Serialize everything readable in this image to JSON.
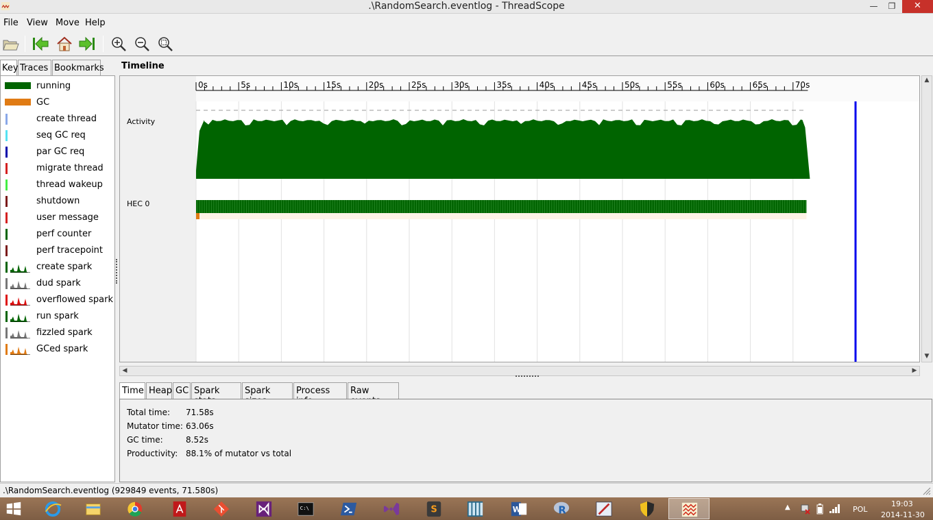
{
  "window": {
    "title": ".\\RandomSearch.eventlog - ThreadScope",
    "minimize_glyph": "—",
    "maximize_glyph": "❐",
    "close_glyph": "✕"
  },
  "menu": [
    {
      "label": "File"
    },
    {
      "label": "View"
    },
    {
      "label": "Move"
    },
    {
      "label": "Help"
    }
  ],
  "toolbar": {
    "buttons": [
      "open-icon",
      "jump-start-icon",
      "home-icon",
      "jump-end-icon",
      "zoom-in-icon",
      "zoom-out-icon",
      "zoom-fit-icon"
    ]
  },
  "left_tabs": [
    {
      "label": "Key",
      "selected": true
    },
    {
      "label": "Traces",
      "selected": false
    },
    {
      "label": "Bookmarks",
      "selected": false
    }
  ],
  "key": [
    {
      "label": "running",
      "type": "bar",
      "color": "#006400"
    },
    {
      "label": "GC",
      "type": "bar",
      "color": "#e07b14"
    },
    {
      "label": "create thread",
      "type": "line",
      "color": "#8aa8e8"
    },
    {
      "label": "seq GC req",
      "type": "line",
      "color": "#55e2f2"
    },
    {
      "label": "par GC req",
      "type": "line",
      "color": "#0000aa"
    },
    {
      "label": "migrate thread",
      "type": "line",
      "color": "#d42020"
    },
    {
      "label": "thread wakeup",
      "type": "line",
      "color": "#44ee44"
    },
    {
      "label": "shutdown",
      "type": "line",
      "color": "#7a1a1a"
    },
    {
      "label": "user message",
      "type": "line",
      "color": "#d42020"
    },
    {
      "label": "perf counter",
      "type": "line",
      "color": "#006400"
    },
    {
      "label": "perf tracepoint",
      "type": "line",
      "color": "#7a1a1a"
    },
    {
      "label": "create spark",
      "type": "spark",
      "color": "#006400"
    },
    {
      "label": "dud spark",
      "type": "spark",
      "color": "#777777"
    },
    {
      "label": "overflowed spark",
      "type": "spark",
      "color": "#dd1111"
    },
    {
      "label": "run spark",
      "type": "spark",
      "color": "#006400"
    },
    {
      "label": "fizzled spark",
      "type": "spark",
      "color": "#777777"
    },
    {
      "label": "GCed spark",
      "type": "spark",
      "color": "#e07b14"
    }
  ],
  "timeline": {
    "title": "Timeline",
    "ticks": [
      "0s",
      "5s",
      "10s",
      "15s",
      "20s",
      "25s",
      "30s",
      "35s",
      "40s",
      "45s",
      "50s",
      "55s",
      "60s",
      "65s",
      "70s"
    ],
    "rows": {
      "activity": "Activity",
      "hec": "HEC 0"
    },
    "colors": {
      "running": "#006400",
      "gc": "#e07b14",
      "cursor": "#0000ee"
    }
  },
  "bottom_tabs": [
    {
      "label": "Time",
      "selected": true
    },
    {
      "label": "Heap",
      "selected": false
    },
    {
      "label": "GC",
      "selected": false
    },
    {
      "label": "Spark stats",
      "selected": false
    },
    {
      "label": "Spark sizes",
      "selected": false
    },
    {
      "label": "Process info",
      "selected": false
    },
    {
      "label": "Raw events",
      "selected": false
    }
  ],
  "stats": [
    {
      "label": "Total time:",
      "value": "71.58s"
    },
    {
      "label": "Mutator time:",
      "value": "63.06s"
    },
    {
      "label": "GC time:",
      "value": "8.52s"
    },
    {
      "label": "Productivity:",
      "value": "88.1% of mutator vs total"
    }
  ],
  "status": ".\\RandomSearch.eventlog (929849 events, 71.580s)",
  "taskbar": {
    "apps": [
      "start-icon",
      "internet-explorer-icon",
      "file-explorer-icon",
      "chrome-icon",
      "acrobat-icon",
      "git-icon",
      "visual-studio-icon",
      "command-prompt-icon",
      "powershell-icon",
      "visual-studio-2-icon",
      "sublime-text-icon",
      "grid-app-icon",
      "word-icon",
      "r-icon",
      "paint-icon",
      "security-shield-icon",
      "threadscope-icon"
    ],
    "language": "POL",
    "time": "19:03",
    "date": "2014-11-30"
  }
}
